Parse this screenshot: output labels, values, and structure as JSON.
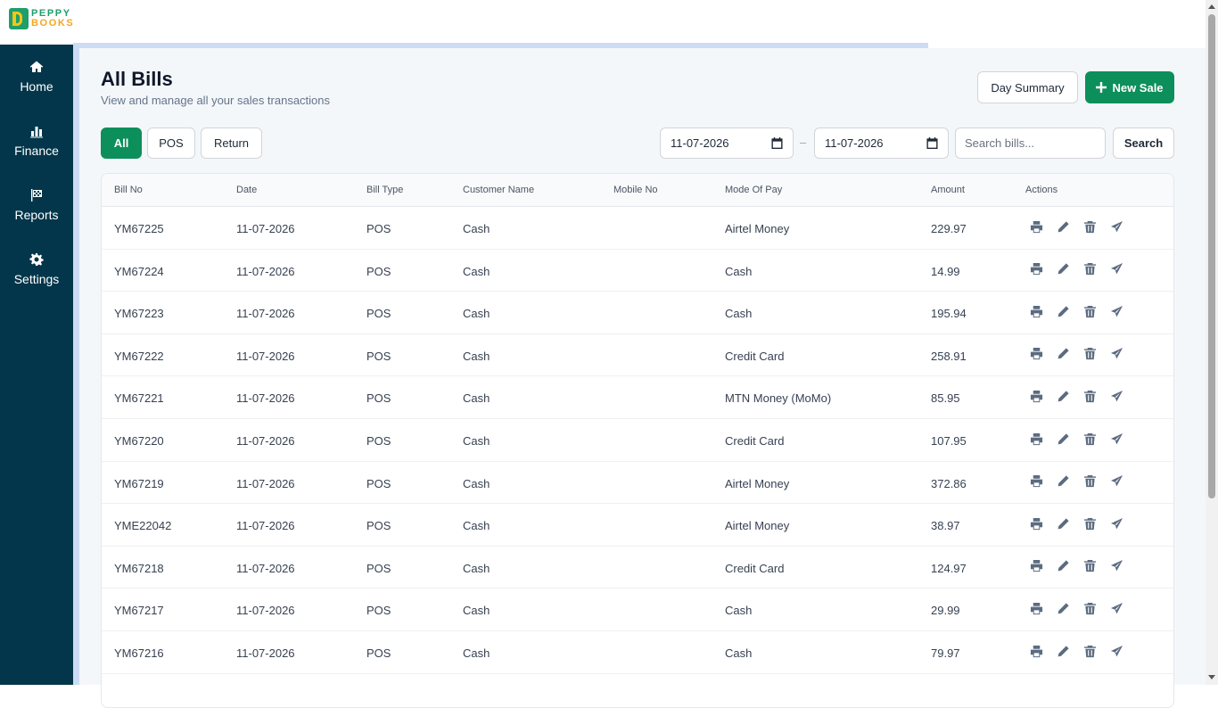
{
  "logo": {
    "line1": "PEPPY",
    "line2": "BOOKS"
  },
  "sidebar": {
    "items": [
      {
        "label": "Home",
        "icon": "home-icon"
      },
      {
        "label": "Finance",
        "icon": "bar-chart-icon"
      },
      {
        "label": "Reports",
        "icon": "flag-checkered-icon"
      },
      {
        "label": "Settings",
        "icon": "gear-icon"
      }
    ]
  },
  "loading_progress": 0.755,
  "header": {
    "title": "All Bills",
    "subtitle": "View and manage all your sales transactions",
    "day_summary_label": "Day Summary",
    "new_sale_label": "New Sale"
  },
  "filters": {
    "tabs": [
      {
        "label": "All",
        "active": true
      },
      {
        "label": "POS",
        "active": false
      },
      {
        "label": "Return",
        "active": false
      }
    ],
    "date_from": "11-07-2026",
    "date_to": "11-07-2026",
    "date_separator": "–",
    "search_placeholder": "Search bills...",
    "search_button": "Search"
  },
  "table": {
    "columns": [
      "Bill No",
      "Date",
      "Bill Type",
      "Customer Name",
      "Mobile No",
      "Mode Of Pay",
      "Amount",
      "Actions"
    ],
    "rows": [
      {
        "bill_no": "YM67225",
        "date": "11-07-2026",
        "type": "POS",
        "customer": "Cash",
        "mobile": "",
        "mode": "Airtel Money",
        "amount": "229.97"
      },
      {
        "bill_no": "YM67224",
        "date": "11-07-2026",
        "type": "POS",
        "customer": "Cash",
        "mobile": "",
        "mode": "Cash",
        "amount": "14.99"
      },
      {
        "bill_no": "YM67223",
        "date": "11-07-2026",
        "type": "POS",
        "customer": "Cash",
        "mobile": "",
        "mode": "Cash",
        "amount": "195.94"
      },
      {
        "bill_no": "YM67222",
        "date": "11-07-2026",
        "type": "POS",
        "customer": "Cash",
        "mobile": "",
        "mode": "Credit Card",
        "amount": "258.91"
      },
      {
        "bill_no": "YM67221",
        "date": "11-07-2026",
        "type": "POS",
        "customer": "Cash",
        "mobile": "",
        "mode": "MTN Money (MoMo)",
        "amount": "85.95"
      },
      {
        "bill_no": "YM67220",
        "date": "11-07-2026",
        "type": "POS",
        "customer": "Cash",
        "mobile": "",
        "mode": "Credit Card",
        "amount": "107.95"
      },
      {
        "bill_no": "YM67219",
        "date": "11-07-2026",
        "type": "POS",
        "customer": "Cash",
        "mobile": "",
        "mode": "Airtel Money",
        "amount": "372.86"
      },
      {
        "bill_no": "YME22042",
        "date": "11-07-2026",
        "type": "POS",
        "customer": "Cash",
        "mobile": "",
        "mode": "Airtel Money",
        "amount": "38.97"
      },
      {
        "bill_no": "YM67218",
        "date": "11-07-2026",
        "type": "POS",
        "customer": "Cash",
        "mobile": "",
        "mode": "Credit Card",
        "amount": "124.97"
      },
      {
        "bill_no": "YM67217",
        "date": "11-07-2026",
        "type": "POS",
        "customer": "Cash",
        "mobile": "",
        "mode": "Cash",
        "amount": "29.99"
      },
      {
        "bill_no": "YM67216",
        "date": "11-07-2026",
        "type": "POS",
        "customer": "Cash",
        "mobile": "",
        "mode": "Cash",
        "amount": "79.97"
      }
    ],
    "row_actions": [
      "print-icon",
      "edit-icon",
      "delete-icon",
      "send-icon"
    ]
  },
  "colors": {
    "sidebar": "#03364a",
    "accent": "#0d8f5b",
    "background": "#f4f7fa",
    "progress": "#cddcf5"
  }
}
